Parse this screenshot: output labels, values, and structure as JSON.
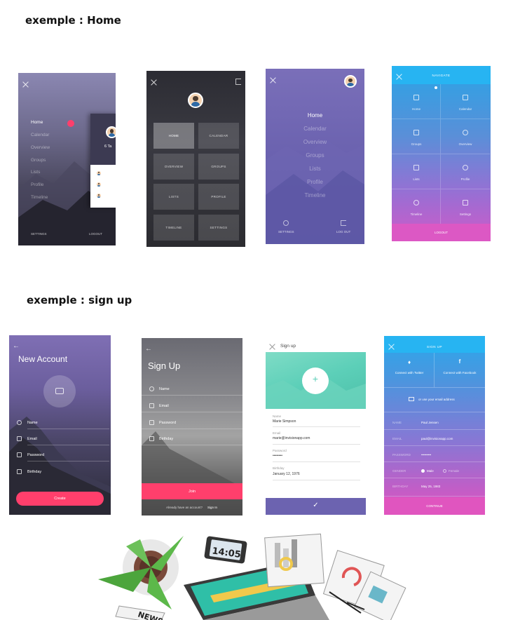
{
  "headings": {
    "home": "exemple : Home",
    "signup": "exemple : sign up"
  },
  "phone1": {
    "menu": [
      "Home",
      "Calendar",
      "Overview",
      "Groups",
      "Lists",
      "Profile",
      "Timeline"
    ],
    "active": "Home",
    "card_text": "6 Ta",
    "settings": "SETTINGS",
    "logout": "LOGOUT"
  },
  "phone2": {
    "tiles": [
      "HOME",
      "CALENDAR",
      "OVERVIEW",
      "GROUPS",
      "LISTS",
      "PROFILE",
      "TIMELINE",
      "SETTINGS"
    ],
    "active": "HOME"
  },
  "phone3": {
    "menu": [
      "Home",
      "Calendar",
      "Overview",
      "Groups",
      "Lists",
      "Profile",
      "Timeline"
    ],
    "active": "Home",
    "settings": "SETTINGS",
    "logout": "LOG OUT"
  },
  "phone4": {
    "title": "NAVIGATE",
    "cells": [
      "Home",
      "Calendar",
      "Groups",
      "Overview",
      "Lists",
      "Profile",
      "Timeline",
      "Settings"
    ],
    "logout": "LOGOUT"
  },
  "signup1": {
    "title": "New Account",
    "fields": [
      "Name",
      "Email",
      "Password",
      "Birthday"
    ],
    "button": "Create"
  },
  "signup2": {
    "title": "Sign Up",
    "fields": [
      "Name",
      "Email",
      "Password",
      "Birthday"
    ],
    "button": "Join",
    "footer": "Already have an account?",
    "footer_link": "Sign In"
  },
  "signup3": {
    "title": "Sign up",
    "fields": [
      {
        "label": "Name",
        "value": "Marie Simpson"
      },
      {
        "label": "Email",
        "value": "marie@invisionapp.com"
      },
      {
        "label": "Password",
        "value": "••••••••"
      },
      {
        "label": "Birthday",
        "value": "January 12, 1976"
      }
    ]
  },
  "signup4": {
    "title": "SIGN UP",
    "twitter": "Connect with Twitter",
    "facebook": "Connect with Facebook",
    "email_link": "or use your email address",
    "fields": [
      {
        "label": "NAME",
        "value": "Paul Jensen"
      },
      {
        "label": "EMAIL",
        "value": "paul@invisionapp.com"
      },
      {
        "label": "PASSWORD",
        "value": "•••••••••"
      },
      {
        "label": "GENDER",
        "value": "Male",
        "alt": "Female"
      },
      {
        "label": "BIRTHDAY",
        "value": "May 25, 1983"
      }
    ],
    "button": "CONTINUE"
  },
  "illustration": {
    "phone_time": "14:05",
    "newspaper": "NEWS"
  },
  "colors": {
    "pink": "#ff3f6c",
    "cyan": "#27b4f2",
    "purple": "#6c63b0",
    "teal": "#5ccfb8"
  }
}
